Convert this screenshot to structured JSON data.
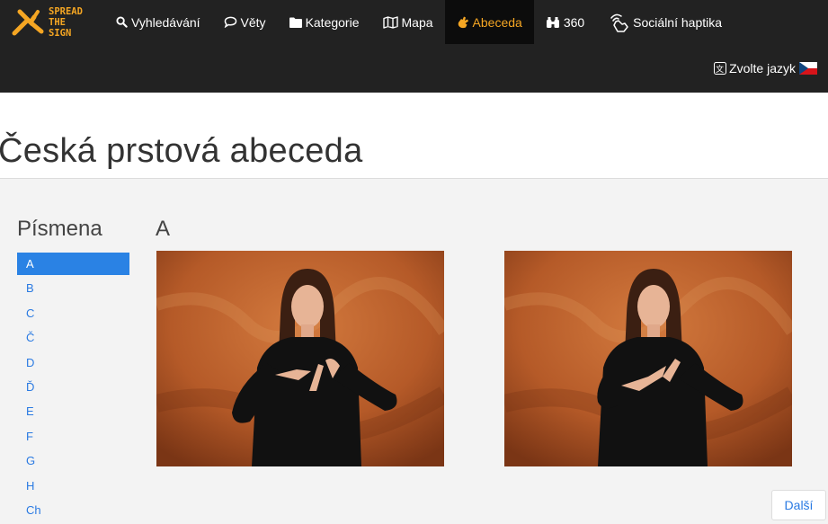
{
  "brand": {
    "line1": "SPREAD",
    "line2": "THE",
    "line3": "SIGN",
    "color": "#f5a623"
  },
  "nav": {
    "items": [
      {
        "label": "Vyhledávání",
        "icon": "search-icon"
      },
      {
        "label": "Věty",
        "icon": "speech-bubble-icon"
      },
      {
        "label": "Kategorie",
        "icon": "folder-icon"
      },
      {
        "label": "Mapa",
        "icon": "map-icon"
      },
      {
        "label": "Abeceda",
        "icon": "hand-icon",
        "active": true
      },
      {
        "label": "360",
        "icon": "binoculars-icon"
      },
      {
        "label": "Sociální haptika",
        "icon": "touch-icon"
      }
    ],
    "language_label": "Zvolte jazyk",
    "language_flag": "czech-flag-icon"
  },
  "page": {
    "title": "Česká prstová abeceda"
  },
  "sidebar": {
    "title": "Písmena",
    "letters": [
      "A",
      "B",
      "C",
      "Č",
      "D",
      "Ď",
      "E",
      "F",
      "G",
      "H",
      "Ch"
    ],
    "active_index": 0
  },
  "main": {
    "current_letter": "A",
    "images": [
      "sign-photo-1",
      "sign-photo-2"
    ],
    "next_label": "Další"
  },
  "colors": {
    "navbar": "#222222",
    "accent": "#f5a623",
    "link": "#2a7ae2",
    "active_bg": "#2a82e4"
  }
}
